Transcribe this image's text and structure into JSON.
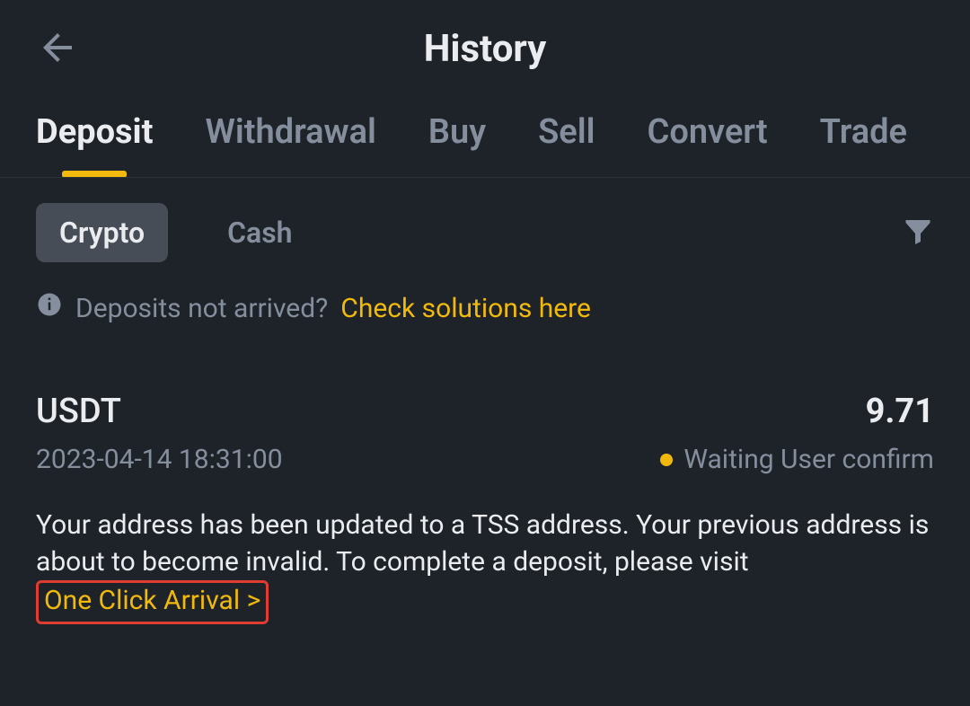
{
  "header": {
    "title": "History"
  },
  "tabs": [
    {
      "label": "Deposit",
      "active": true
    },
    {
      "label": "Withdrawal",
      "active": false
    },
    {
      "label": "Buy",
      "active": false
    },
    {
      "label": "Sell",
      "active": false
    },
    {
      "label": "Convert",
      "active": false
    },
    {
      "label": "Trade",
      "active": false
    }
  ],
  "subtabs": [
    {
      "label": "Crypto",
      "active": true
    },
    {
      "label": "Cash",
      "active": false
    }
  ],
  "notice": {
    "text": "Deposits not arrived?",
    "link": "Check solutions here"
  },
  "transaction": {
    "asset": "USDT",
    "amount": "9.71",
    "datetime": "2023-04-14 18:31:00",
    "status": "Waiting User confirm",
    "status_color": "#f0b90b",
    "message_prefix": "Your address has been updated to a TSS address. Your previous address is about to become invalid. To complete a deposit, please visit",
    "message_link": "One Click Arrival >"
  },
  "colors": {
    "accent": "#f0b90b",
    "bg": "#1e2329",
    "text_secondary": "#848e9c",
    "highlight_border": "#e03c31"
  }
}
